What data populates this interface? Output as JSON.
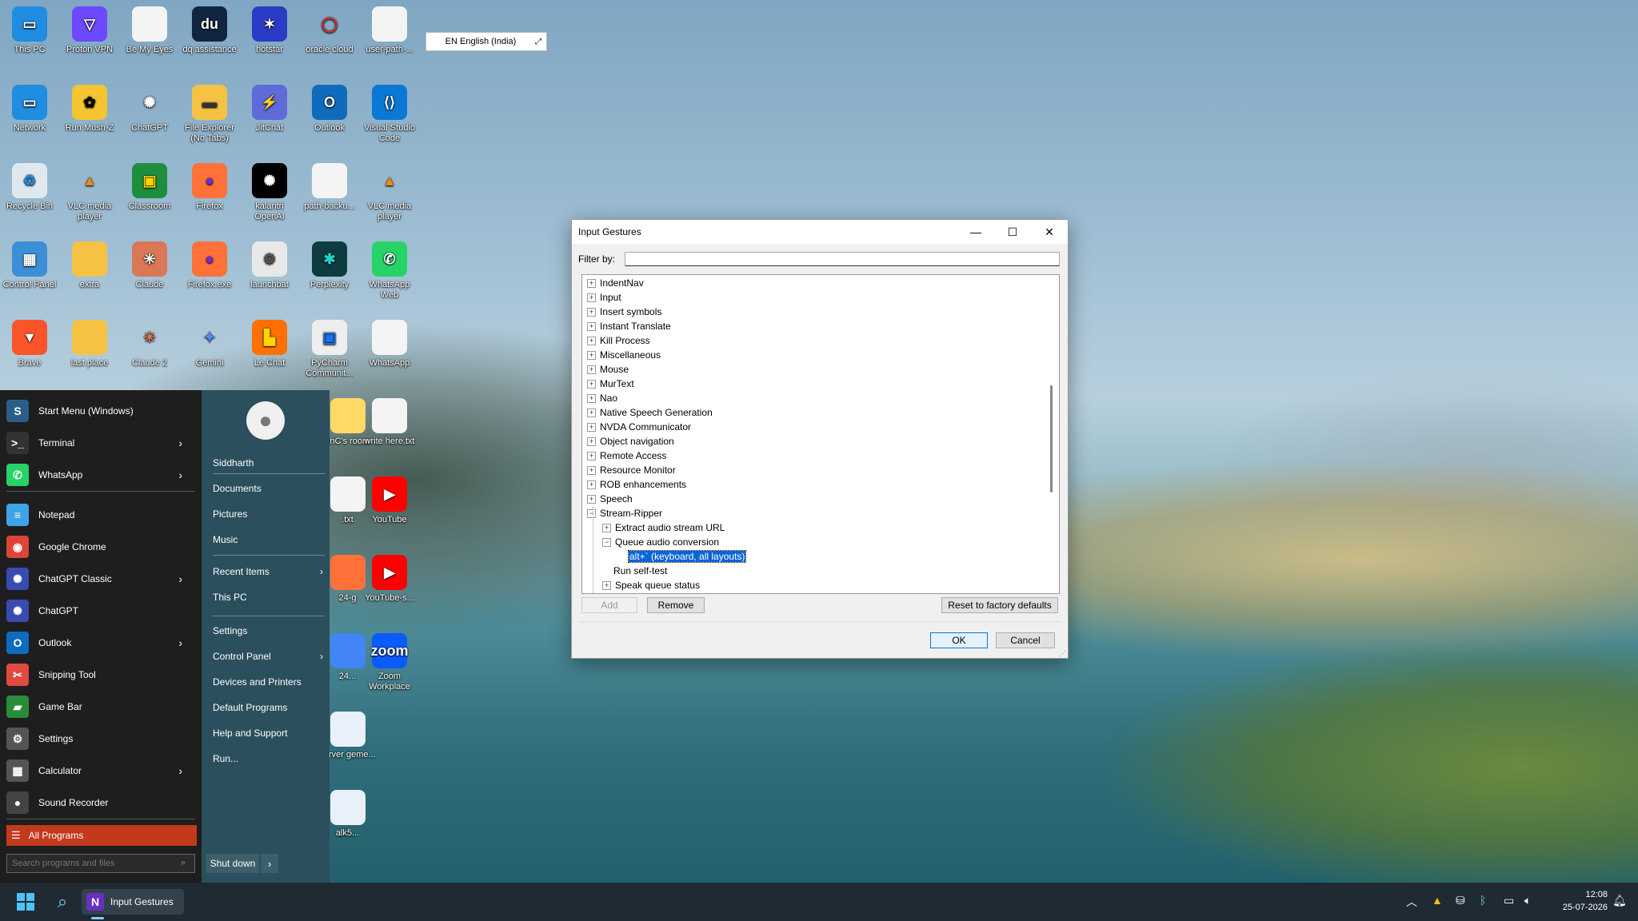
{
  "desktop": {
    "icons": [
      {
        "label": "This PC",
        "glyph": "▭",
        "bg": "#1f8de0",
        "fg": "#fff"
      },
      {
        "label": "Proton VPN",
        "glyph": "▽",
        "bg": "#6d4aff",
        "fg": "#fff"
      },
      {
        "label": "Be My Eyes",
        "glyph": "",
        "bg": "#f4f4f4",
        "fg": "#333"
      },
      {
        "label": "dq assistance",
        "glyph": "du",
        "bg": "#0f2540",
        "fg": "#fff"
      },
      {
        "label": "hotstar",
        "glyph": "✶",
        "bg": "#2b3cc4",
        "fg": "#fff"
      },
      {
        "label": "oracle cloud",
        "glyph": "◯",
        "bg": "transparent",
        "fg": "#e0302b"
      },
      {
        "label": "user-path-...",
        "glyph": "",
        "bg": "#f4f4f4",
        "fg": "#333"
      },
      {
        "label": "Network",
        "glyph": "▭",
        "bg": "#1f8de0",
        "fg": "#fff"
      },
      {
        "label": "Run Mush-Z",
        "glyph": "✿",
        "bg": "#f2c531",
        "fg": "#000"
      },
      {
        "label": "ChatGPT",
        "glyph": "✺",
        "bg": "transparent",
        "fg": "#fff"
      },
      {
        "label": "File Explorer (No Tabs)",
        "glyph": "▬",
        "bg": "#f6c244",
        "fg": "#333"
      },
      {
        "label": "JitChat",
        "glyph": "⚡",
        "bg": "#5e6bd8",
        "fg": "#ffd400"
      },
      {
        "label": "Outlook",
        "glyph": "O",
        "bg": "#0f6cbd",
        "fg": "#fff"
      },
      {
        "label": "Visual Studio Code",
        "glyph": "⟨⟩",
        "bg": "#0a79d6",
        "fg": "#fff"
      },
      {
        "label": "Recycle Bin",
        "glyph": "♻",
        "bg": "#dfe8ee",
        "fg": "#1f8de0"
      },
      {
        "label": "VLC media player",
        "glyph": "▲",
        "bg": "transparent",
        "fg": "#f08a0a"
      },
      {
        "label": "Classroom",
        "glyph": "▣",
        "bg": "#1e8e3e",
        "fg": "#ffd400"
      },
      {
        "label": "Firefox",
        "glyph": "●",
        "bg": "#ff7139",
        "fg": "#6e2bd9"
      },
      {
        "label": "kalantri OpenAI",
        "glyph": "✺",
        "bg": "#000",
        "fg": "#fff"
      },
      {
        "label": "path-backu...",
        "glyph": "",
        "bg": "#f4f4f4",
        "fg": "#333"
      },
      {
        "label": "VLC media player",
        "glyph": "▲",
        "bg": "transparent",
        "fg": "#f08a0a"
      },
      {
        "label": "Control Panel",
        "glyph": "▦",
        "bg": "#3b8fd6",
        "fg": "#fff"
      },
      {
        "label": "extra",
        "glyph": "",
        "bg": "#f6c244",
        "fg": "#333"
      },
      {
        "label": "Claude",
        "glyph": "✳",
        "bg": "#d97757",
        "fg": "#fff"
      },
      {
        "label": "Firefox.exe",
        "glyph": "●",
        "bg": "#ff7139",
        "fg": "#6e2bd9"
      },
      {
        "label": "launchbat",
        "glyph": "⚙",
        "bg": "#e8e8e8",
        "fg": "#555"
      },
      {
        "label": "Perplexity",
        "glyph": "✱",
        "bg": "#0c3c40",
        "fg": "#20d0c8"
      },
      {
        "label": "WhatsApp Web",
        "glyph": "✆",
        "bg": "#25d366",
        "fg": "#fff"
      },
      {
        "label": "Brave",
        "glyph": "▼",
        "bg": "#fb542b",
        "fg": "#fff"
      },
      {
        "label": "last place",
        "glyph": "",
        "bg": "#f6c244",
        "fg": "#333"
      },
      {
        "label": "Claude 2",
        "glyph": "✳",
        "bg": "transparent",
        "fg": "#d97757"
      },
      {
        "label": "Gemini",
        "glyph": "✦",
        "bg": "transparent",
        "fg": "#4a8cf0"
      },
      {
        "label": "Le Chat",
        "glyph": "▙",
        "bg": "#ff7000",
        "fg": "#ffd400"
      },
      {
        "label": "PyCharm Communit...",
        "glyph": "▣",
        "bg": "#eee",
        "fg": "#1a73e8"
      },
      {
        "label": "WhatsApp",
        "glyph": "",
        "bg": "#f4f4f4",
        "fg": "#333"
      },
      {
        "label": "tinC's room",
        "glyph": "",
        "bg": "#ffd966",
        "fg": "#333"
      },
      {
        "label": "write here.txt",
        "glyph": "",
        "bg": "#f4f4f4",
        "fg": "#333"
      },
      {
        "label": ".txt",
        "glyph": "",
        "bg": "#f4f4f4",
        "fg": "#333"
      },
      {
        "label": "YouTube",
        "glyph": "▶",
        "bg": "#ff0000",
        "fg": "#fff"
      },
      {
        "label": "24-g",
        "glyph": "",
        "bg": "#ff7139",
        "fg": "#fff"
      },
      {
        "label": "YouTube-s...",
        "glyph": "▶",
        "bg": "#ff0000",
        "fg": "#fff"
      },
      {
        "label": "24...",
        "glyph": "",
        "bg": "#4285f4",
        "fg": "#fff"
      },
      {
        "label": "Zoom Workplace",
        "glyph": "zoom",
        "bg": "#0b5cff",
        "fg": "#fff"
      },
      {
        "label": "server geme...",
        "glyph": "",
        "bg": "#e8f0fa",
        "fg": "#1a73e8"
      },
      {
        "label": "alk5...",
        "glyph": "",
        "bg": "#e8f0fa",
        "fg": "#1a73e8"
      }
    ]
  },
  "language_bar": {
    "text": "EN English (India)"
  },
  "start_menu": {
    "left_items": [
      {
        "label": "Start Menu (Windows)",
        "glyph": "S",
        "bg": "#2c5d8a",
        "arrow": false
      },
      {
        "label": "Terminal",
        "glyph": ">_",
        "bg": "#333",
        "arrow": true
      },
      {
        "label": "WhatsApp",
        "glyph": "✆",
        "bg": "#25d366",
        "arrow": true
      },
      {
        "label": "Notepad",
        "glyph": "≡",
        "bg": "#3fa3e8",
        "arrow": false
      },
      {
        "label": "Google Chrome",
        "glyph": "◉",
        "bg": "#db4437",
        "arrow": false
      },
      {
        "label": "ChatGPT Classic",
        "glyph": "✺",
        "bg": "#3a4bb0",
        "arrow": true
      },
      {
        "label": "ChatGPT",
        "glyph": "✺",
        "bg": "#3a4bb0",
        "arrow": false
      },
      {
        "label": "Outlook",
        "glyph": "O",
        "bg": "#0f6cbd",
        "arrow": true
      },
      {
        "label": "Snipping Tool",
        "glyph": "✂",
        "bg": "#e04a3f",
        "arrow": false
      },
      {
        "label": "Game Bar",
        "glyph": "▰",
        "bg": "#2a8c3a",
        "arrow": false
      },
      {
        "label": "Settings",
        "glyph": "⚙",
        "bg": "#555",
        "arrow": false
      },
      {
        "label": "Calculator",
        "glyph": "▦",
        "bg": "#555",
        "arrow": true
      },
      {
        "label": "Sound Recorder",
        "glyph": "●",
        "bg": "#444",
        "arrow": false
      }
    ],
    "all_programs": "All Programs",
    "search_placeholder": "Search programs and files",
    "user": "Siddharth",
    "right_items": [
      {
        "label": "Documents",
        "arrow": false
      },
      {
        "label": "Pictures",
        "arrow": false
      },
      {
        "label": "Music",
        "arrow": false
      },
      {
        "label": "Recent Items",
        "arrow": true
      },
      {
        "label": "This PC",
        "arrow": false
      },
      {
        "label": "Settings",
        "arrow": false
      },
      {
        "label": "Control Panel",
        "arrow": true
      },
      {
        "label": "Devices and Printers",
        "arrow": false
      },
      {
        "label": "Default Programs",
        "arrow": false
      },
      {
        "label": "Help and Support",
        "arrow": false
      },
      {
        "label": "Run...",
        "arrow": false
      }
    ],
    "shutdown": "Shut down"
  },
  "dialog": {
    "title": "Input Gestures",
    "filter_label": "Filter by:",
    "filter_value": "",
    "tree": [
      {
        "label": "IndentNav",
        "level": 0,
        "exp": "+"
      },
      {
        "label": "Input",
        "level": 0,
        "exp": "+"
      },
      {
        "label": "Insert symbols",
        "level": 0,
        "exp": "+"
      },
      {
        "label": "Instant Translate",
        "level": 0,
        "exp": "+"
      },
      {
        "label": "Kill Process",
        "level": 0,
        "exp": "+"
      },
      {
        "label": "Miscellaneous",
        "level": 0,
        "exp": "+"
      },
      {
        "label": "Mouse",
        "level": 0,
        "exp": "+"
      },
      {
        "label": "MurText",
        "level": 0,
        "exp": "+"
      },
      {
        "label": "Nao",
        "level": 0,
        "exp": "+"
      },
      {
        "label": "Native Speech Generation",
        "level": 0,
        "exp": "+"
      },
      {
        "label": "NVDA Communicator",
        "level": 0,
        "exp": "+"
      },
      {
        "label": "Object navigation",
        "level": 0,
        "exp": "+"
      },
      {
        "label": "Remote Access",
        "level": 0,
        "exp": "+"
      },
      {
        "label": "Resource Monitor",
        "level": 0,
        "exp": "+"
      },
      {
        "label": "ROB enhancements",
        "level": 0,
        "exp": "+"
      },
      {
        "label": "Speech",
        "level": 0,
        "exp": "+"
      },
      {
        "label": "Stream-Ripper",
        "level": 0,
        "exp": "−"
      },
      {
        "label": "Extract audio stream URL",
        "level": 1,
        "exp": "+"
      },
      {
        "label": "Queue audio conversion",
        "level": 1,
        "exp": "−"
      },
      {
        "label": "alt+` (keyboard, all layouts)",
        "level": 2,
        "exp": "",
        "selected": true
      },
      {
        "label": "Run self-test",
        "level": 1,
        "exp": ""
      },
      {
        "label": "Speak queue status",
        "level": 1,
        "exp": "+"
      }
    ],
    "buttons": {
      "add": "Add",
      "remove": "Remove",
      "reset": "Reset to factory defaults",
      "ok": "OK",
      "cancel": "Cancel"
    }
  },
  "taskbar": {
    "active_app": "Input Gestures",
    "time": "12:08",
    "date": "25-07-2026"
  }
}
